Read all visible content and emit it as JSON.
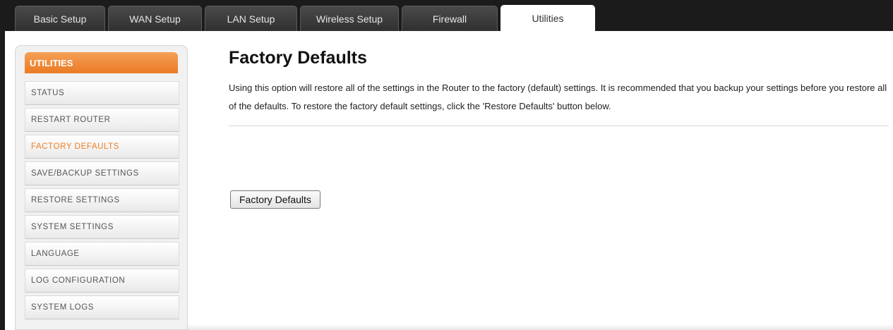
{
  "tabs": [
    {
      "label": "Basic Setup",
      "active": false
    },
    {
      "label": "WAN Setup",
      "active": false
    },
    {
      "label": "LAN Setup",
      "active": false
    },
    {
      "label": "Wireless Setup",
      "active": false
    },
    {
      "label": "Firewall",
      "active": false
    },
    {
      "label": "Utilities",
      "active": true
    }
  ],
  "sidebar": {
    "header": "UTILITIES",
    "items": [
      {
        "label": "STATUS",
        "active": false
      },
      {
        "label": "RESTART ROUTER",
        "active": false
      },
      {
        "label": "FACTORY DEFAULTS",
        "active": true
      },
      {
        "label": "SAVE/BACKUP SETTINGS",
        "active": false
      },
      {
        "label": "RESTORE SETTINGS",
        "active": false
      },
      {
        "label": "SYSTEM SETTINGS",
        "active": false
      },
      {
        "label": "LANGUAGE",
        "active": false
      },
      {
        "label": "LOG CONFIGURATION",
        "active": false
      },
      {
        "label": "SYSTEM LOGS",
        "active": false
      }
    ]
  },
  "main": {
    "title": "Factory Defaults",
    "description": "Using this option will restore all of the settings in the Router to the factory (default) settings. It is recommended that you backup your settings before you restore all of the defaults. To restore the factory default settings, click the 'Restore Defaults' button below.",
    "button_label": "Factory Defaults"
  },
  "colors": {
    "accent": "#f07d1f",
    "topbar": "#1b1b1b",
    "active_tab": "#ffffff"
  }
}
